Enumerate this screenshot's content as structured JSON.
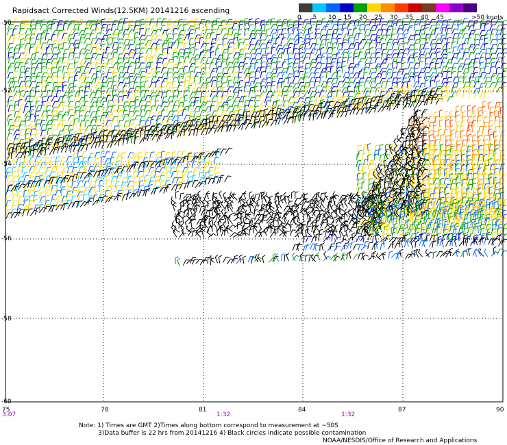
{
  "title": "Rapidsact Corrected Winds(12.5KM) 20141216 ascending",
  "legend": {
    "unit_label": ">50 knots",
    "ticks": [
      "0",
      "5",
      "10",
      "15",
      "20",
      "25",
      "30",
      "35",
      "40",
      "45"
    ],
    "colors": [
      "#3c3c3c",
      "#00c8ff",
      "#0064ff",
      "#0000c8",
      "#00a000",
      "#ffd700",
      "#ff8c00",
      "#ff3c00",
      "#cc0000",
      "#7a3b1e",
      "#ff00ff",
      "#8b00cc",
      "#4b0082"
    ]
  },
  "axes": {
    "lon_ticks": [
      "75",
      "78",
      "81",
      "84",
      "87",
      "90"
    ],
    "lat_ticks": [
      "-50",
      "-52",
      "-54",
      "-56",
      "-58",
      "-60"
    ]
  },
  "times": [
    "3:07",
    "1:32",
    "1:32"
  ],
  "notes": {
    "line1": "Note: 1) Times are GMT 2)Times along bottom correspond to measurement at ~50S",
    "line2": "3)Data buffer is 22 hrs from 20141216 4) Black circles indicate possible contamination",
    "line3": "NOAA/NESDIS/Office of Research and Applications"
  }
}
